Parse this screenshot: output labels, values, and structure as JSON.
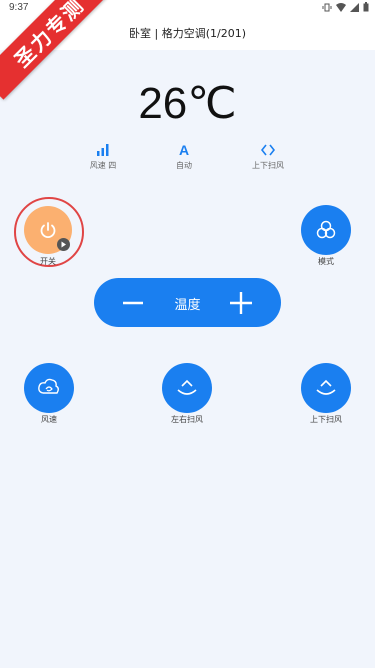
{
  "status_bar": {
    "time": "9:37"
  },
  "header": {
    "title": "卧室 | 格力空调(1/201)"
  },
  "banner": {
    "text": "圣力专测"
  },
  "temperature": {
    "value": "26℃"
  },
  "status_row": [
    {
      "icon": "signal-bars-icon",
      "label": "风速 四"
    },
    {
      "icon": "letter-a-icon",
      "glyph": "A",
      "label": "自动"
    },
    {
      "icon": "swing-vertical-icon",
      "glyph": "<>",
      "label": "上下扫风"
    }
  ],
  "buttons": {
    "power": {
      "label": "开关"
    },
    "mode": {
      "label": "模式"
    },
    "fan_speed": {
      "label": "风速"
    },
    "swing_lr": {
      "label": "左右扫风"
    },
    "swing_ud": {
      "label": "上下扫风"
    }
  },
  "temp_control": {
    "label": "温度"
  },
  "colors": {
    "accent": "#1a7ff0",
    "power": "#fbb070",
    "ring": "#e04545",
    "banner": "#e53030",
    "background": "#f1f5fc"
  }
}
